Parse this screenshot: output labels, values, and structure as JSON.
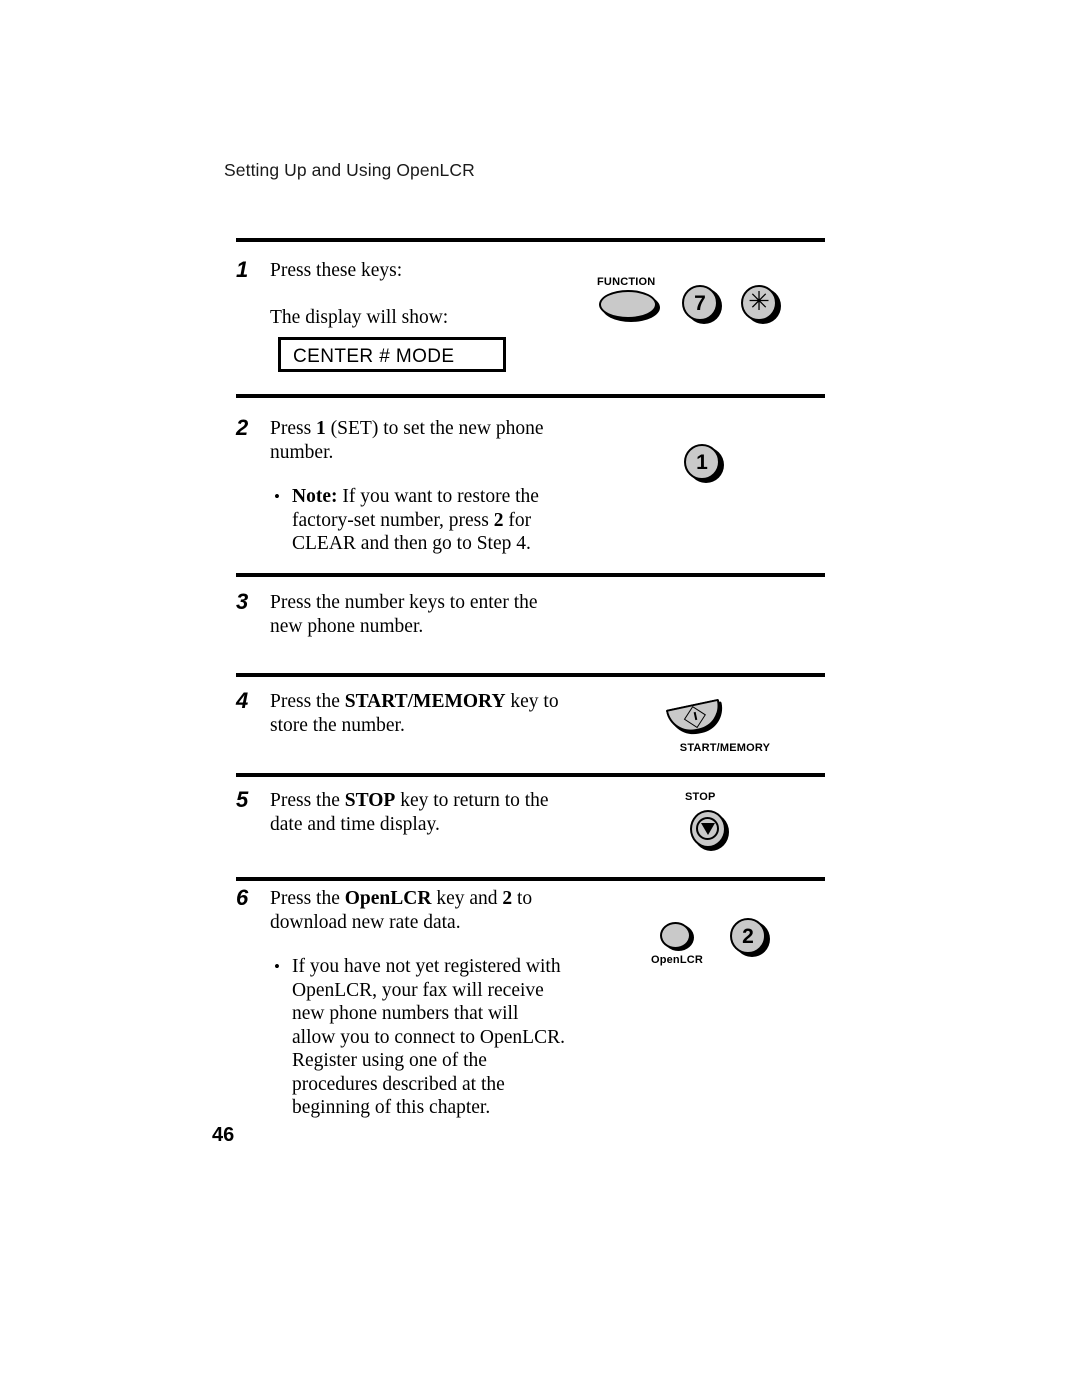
{
  "document": {
    "running_header": "Setting Up and Using OpenLCR",
    "page_number": "46"
  },
  "lcd_display": {
    "text": "CENTER # MODE"
  },
  "steps": [
    {
      "number": "1",
      "line1": "Press these keys:",
      "line2": "The display will show:"
    },
    {
      "number": "2",
      "text_a": "Press ",
      "text_b": "1",
      "text_c": " (SET) to set the new phone number.",
      "note_label": "Note:",
      "note_a": " If you want to restore the factory-set number, press ",
      "note_b": "2",
      "note_c": " for CLEAR and then go to Step 4."
    },
    {
      "number": "3",
      "text": "Press the number keys to enter the new phone number."
    },
    {
      "number": "4",
      "text_a": "Press the ",
      "text_b": "START/MEMORY",
      "text_c": " key to store the number."
    },
    {
      "number": "5",
      "text_a": "Press the ",
      "text_b": "STOP",
      "text_c": " key to return to the date and time display."
    },
    {
      "number": "6",
      "text_a": "Press the ",
      "text_b": "OpenLCR",
      "text_c": " key and ",
      "text_d": "2",
      "text_e": " to download new rate data.",
      "bullet": "If you have not yet registered with OpenLCR, your fax will receive new phone numbers that will allow you to connect to OpenLCR. Register using one of the procedures described at the beginning of this chapter."
    }
  ],
  "keys": {
    "function_label": "FUNCTION",
    "seven_label": "7",
    "asterisk_label": "✳",
    "one_label": "1",
    "start_memory_label": "START/MEMORY",
    "stop_label": "STOP",
    "openlcr_label": "OpenLCR",
    "two_label": "2"
  },
  "colors": {
    "key_fill": "#c9c9c9",
    "ink": "#000000",
    "paper": "#ffffff"
  }
}
